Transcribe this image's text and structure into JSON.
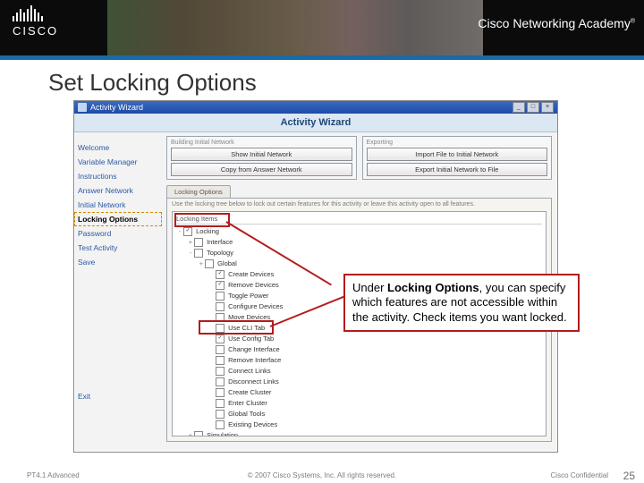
{
  "header": {
    "brand": "CISCO",
    "academy": "Cisco Networking Academy",
    "reg": "®"
  },
  "slide": {
    "title": "Set Locking Options"
  },
  "window": {
    "title": "Activity Wizard",
    "headerText": "Activity Wizard",
    "nav": [
      "Welcome",
      "Variable Manager",
      "Instructions",
      "Answer Network",
      "Initial Network",
      "Locking Options",
      "Password",
      "Test Activity",
      "Save"
    ],
    "exit": "Exit",
    "leftBox": {
      "title": "Building Initial Network",
      "btnShow": "Show Initial Network",
      "btnCopy": "Copy from Answer Network"
    },
    "rightBox": {
      "title": "Exporting",
      "btnImport": "Import File to Initial Network",
      "btnExport": "Export Initial Network to File"
    },
    "tab": "Locking Options",
    "hint": "Use the locking tree below to lock out certain features for this activity or leave this activity open to all features.",
    "treeHead": "Locking Items",
    "tree": [
      {
        "lvl": 0,
        "t": "-",
        "c": true,
        "l": "Locking"
      },
      {
        "lvl": 1,
        "t": "+",
        "c": false,
        "l": "Interface"
      },
      {
        "lvl": 1,
        "t": "-",
        "c": false,
        "l": "Topology"
      },
      {
        "lvl": 2,
        "t": "+",
        "c": false,
        "l": "Global"
      },
      {
        "lvl": 3,
        "t": "",
        "c": true,
        "l": "Create Devices"
      },
      {
        "lvl": 3,
        "t": "",
        "c": true,
        "l": "Remove Devices"
      },
      {
        "lvl": 3,
        "t": "",
        "c": false,
        "l": "Toggle Power"
      },
      {
        "lvl": 3,
        "t": "",
        "c": false,
        "l": "Configure Devices"
      },
      {
        "lvl": 3,
        "t": "",
        "c": false,
        "l": "Move Devices"
      },
      {
        "lvl": 3,
        "t": "",
        "c": false,
        "l": "Use CLI Tab"
      },
      {
        "lvl": 3,
        "t": "",
        "c": true,
        "l": "Use Config Tab"
      },
      {
        "lvl": 3,
        "t": "",
        "c": false,
        "l": "Change Interface"
      },
      {
        "lvl": 3,
        "t": "",
        "c": false,
        "l": "Remove Interface"
      },
      {
        "lvl": 3,
        "t": "",
        "c": false,
        "l": "Connect Links"
      },
      {
        "lvl": 3,
        "t": "",
        "c": false,
        "l": "Disconnect Links"
      },
      {
        "lvl": 3,
        "t": "",
        "c": false,
        "l": "Create Cluster"
      },
      {
        "lvl": 3,
        "t": "",
        "c": false,
        "l": "Enter Cluster"
      },
      {
        "lvl": 3,
        "t": "",
        "c": false,
        "l": "Global Tools"
      },
      {
        "lvl": 3,
        "t": "",
        "c": false,
        "l": "Existing Devices"
      },
      {
        "lvl": 1,
        "t": "+",
        "c": false,
        "l": "Simulation"
      }
    ]
  },
  "callout": {
    "pre": "Under ",
    "bold": "Locking Options",
    "post": ", you can specify which features are not accessible within the activity. Check items you want locked."
  },
  "footer": {
    "left": "PT4.1 Advanced",
    "center": "© 2007 Cisco Systems, Inc. All rights reserved.",
    "right": "Cisco Confidential",
    "page": "25"
  }
}
